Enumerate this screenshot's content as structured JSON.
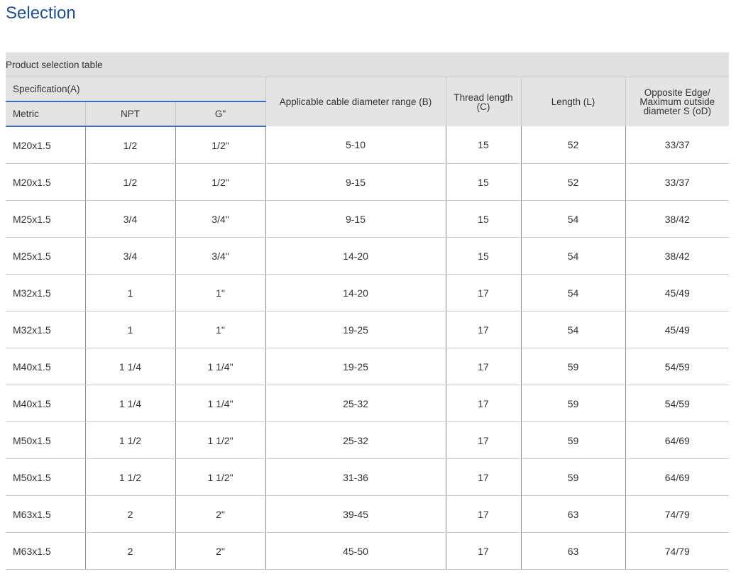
{
  "page": {
    "title": "Selection"
  },
  "table": {
    "caption": "Product selection table",
    "headers": {
      "specification": "Specification(A)",
      "metric": "Metric",
      "npt": "NPT",
      "g": "G\"",
      "cable_range": "Applicable cable diameter range (B)",
      "thread_length_1": "Thread length",
      "thread_length_2": "(C)",
      "length": "Length  (L)",
      "opposite_1": "Opposite Edge/",
      "opposite_2": "Maximum outside",
      "opposite_3": "diameter S (oD)"
    },
    "rows": [
      [
        "M20x1.5",
        "1/2",
        "1/2\"",
        "5-10",
        "15",
        "52",
        "33/37"
      ],
      [
        "M20x1.5",
        "1/2",
        "1/2\"",
        "9-15",
        "15",
        "52",
        "33/37"
      ],
      [
        "M25x1.5",
        "3/4",
        "3/4\"",
        "9-15",
        "15",
        "54",
        "38/42"
      ],
      [
        "M25x1.5",
        "3/4",
        "3/4\"",
        "14-20",
        "15",
        "54",
        "38/42"
      ],
      [
        "M32x1.5",
        "1",
        "1\"",
        "14-20",
        "17",
        "54",
        "45/49"
      ],
      [
        "M32x1.5",
        "1",
        "1\"",
        "19-25",
        "17",
        "54",
        "45/49"
      ],
      [
        "M40x1.5",
        "1 1/4",
        "1 1/4\"",
        "19-25",
        "17",
        "59",
        "54/59"
      ],
      [
        "M40x1.5",
        "1 1/4",
        "1 1/4\"",
        "25-32",
        "17",
        "59",
        "54/59"
      ],
      [
        "M50x1.5",
        "1 1/2",
        "1 1/2\"",
        "25-32",
        "17",
        "59",
        "64/69"
      ],
      [
        "M50x1.5",
        "1 1/2",
        "1 1/2\"",
        "31-36",
        "17",
        "59",
        "64/69"
      ],
      [
        "M63x1.5",
        "2",
        "2\"",
        "39-45",
        "17",
        "63",
        "74/79"
      ],
      [
        "M63x1.5",
        "2",
        "2\"",
        "45-50",
        "17",
        "63",
        "74/79"
      ]
    ]
  },
  "colors": {
    "title": "#1d4f9c",
    "header_background": "#e0e0e0",
    "header_rule": "#3a6ec2",
    "text": "#333333"
  }
}
